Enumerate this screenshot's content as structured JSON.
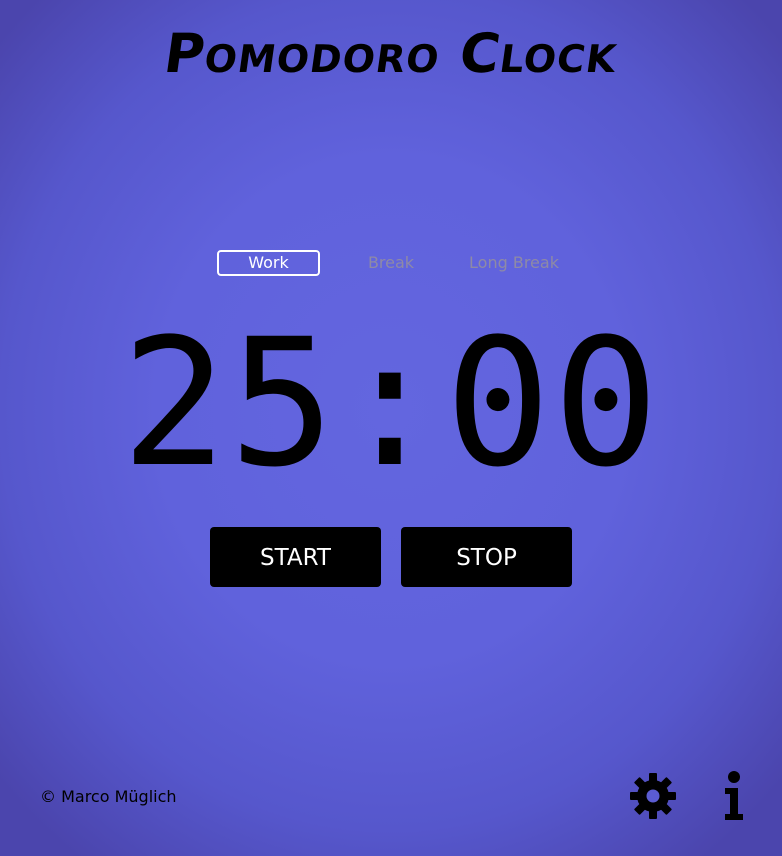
{
  "app": {
    "title": "Pomodoro Clock"
  },
  "tabs": [
    {
      "label": "Work",
      "active": true
    },
    {
      "label": "Break",
      "active": false
    },
    {
      "label": "Long Break",
      "active": false
    }
  ],
  "timer": {
    "display": "25:00"
  },
  "controls": {
    "start_label": "START",
    "stop_label": "STOP"
  },
  "footer": {
    "credit": "© Marco Müglich",
    "icons": [
      "gear-icon",
      "info-icon"
    ]
  },
  "colors": {
    "background": "#6062dc",
    "active_tab": "#ffffff",
    "inactive_tab": "#8e8aa6",
    "button_bg": "#000000",
    "button_text": "#ffffff"
  }
}
